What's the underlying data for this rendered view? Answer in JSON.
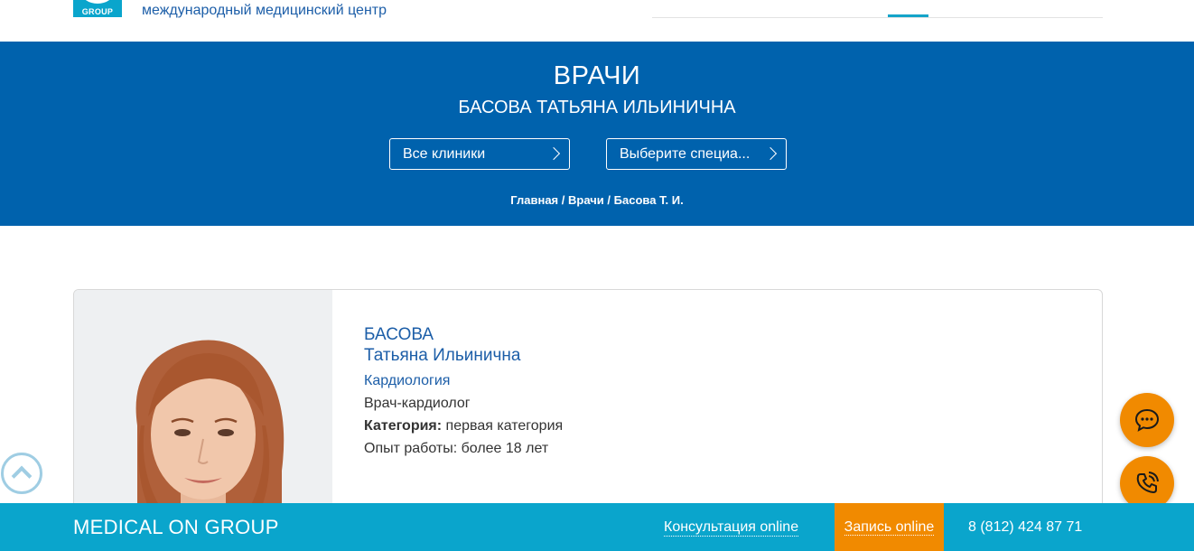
{
  "header": {
    "logo_text": "GROUP",
    "tagline": "международный медицинский центр"
  },
  "hero": {
    "title": "ВРАЧИ",
    "subtitle": "БАСОВА ТАТЬЯНА ИЛЬИНИЧНА",
    "clinic_select": "Все клиники",
    "specialty_select": "Выберите специа...",
    "breadcrumb": [
      "Главная",
      "Врачи",
      "Басова Т. И."
    ],
    "breadcrumb_sep": "/"
  },
  "doctor": {
    "surname": "БАСОВА",
    "given_names": "Татьяна Ильинична",
    "specialty": "Кардиология",
    "position": "Врач-кардиолог",
    "category_label": "Категория:",
    "category_value": "первая категория",
    "experience": "Опыт работы: более 18 лет"
  },
  "footer": {
    "brand": "MEDICAL ON GROUP",
    "consult": "Консультация online",
    "booking": "Запись online",
    "phone": "8 (812) 424 87 71"
  },
  "colors": {
    "primary_blue": "#0062ad",
    "cyan": "#0aa5cc",
    "orange": "#f18a00",
    "link_blue": "#1c5ea8"
  },
  "icons": {
    "chat": "chat-bubble-icon",
    "call": "phone-call-icon",
    "scroll_up": "chevron-up-icon",
    "select_arrow": "chevron-right-icon"
  }
}
